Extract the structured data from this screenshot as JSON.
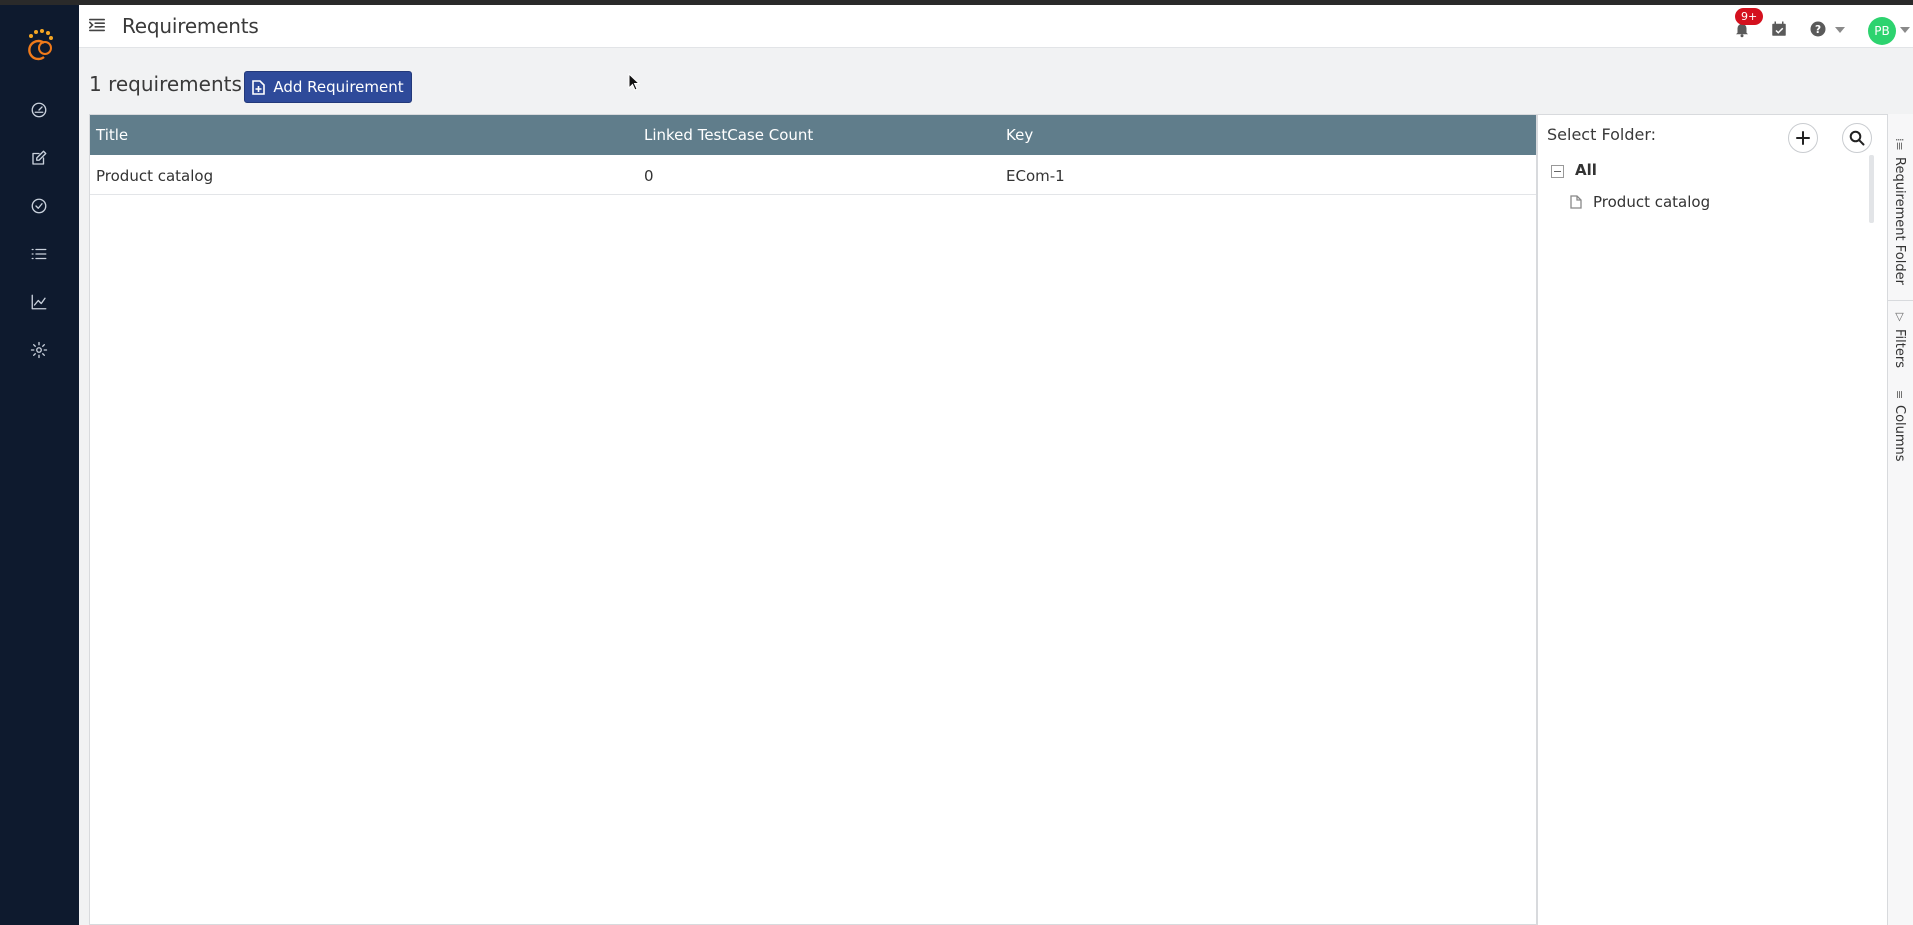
{
  "header": {
    "title": "Requirements",
    "notification_badge": "9+",
    "avatar_initials": "PB"
  },
  "sidebar": {
    "items": [
      {
        "name": "dashboard",
        "icon": "gauge-icon"
      },
      {
        "name": "edit",
        "icon": "edit-icon"
      },
      {
        "name": "check",
        "icon": "check-circle-icon"
      },
      {
        "name": "list",
        "icon": "list-icon"
      },
      {
        "name": "reports",
        "icon": "chart-line-icon"
      },
      {
        "name": "settings",
        "icon": "gear-icon"
      }
    ]
  },
  "toolbar": {
    "count_label": "1 requirements",
    "add_button_label": "Add Requirement"
  },
  "grid": {
    "columns": [
      "Title",
      "Linked TestCase Count",
      "Key"
    ],
    "rows": [
      [
        "Product catalog",
        "0",
        "ECom-1"
      ]
    ]
  },
  "folder_panel": {
    "label": "Select Folder:",
    "root": "All",
    "folders": [
      "Product catalog"
    ]
  },
  "side_tabs": [
    "Requirement Folder",
    "Filters",
    "Columns"
  ],
  "colors": {
    "sidebar_bg": "#0e1a2e",
    "grid_header_bg": "#607d8b",
    "primary_button": "#2e4a9a",
    "badge": "#d4111e",
    "avatar": "#2dd36f"
  }
}
